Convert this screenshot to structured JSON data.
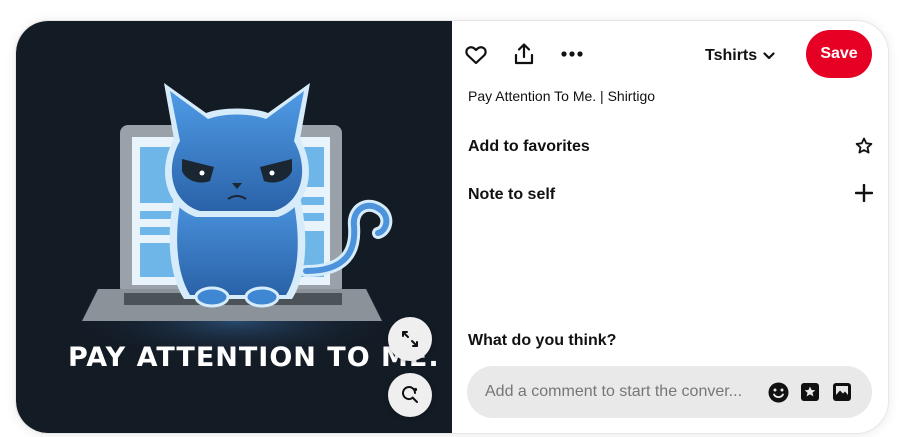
{
  "media": {
    "artwork_caption": "PAY ATTENTION TO ME.",
    "expand_icon": "expand-arrows-icon",
    "visual_search_icon": "visual-search-icon"
  },
  "toolbar": {
    "like_icon": "heart-icon",
    "share_icon": "share-icon",
    "more_icon": "ellipsis-icon",
    "board_name": "Tshirts",
    "save_label": "Save"
  },
  "pin": {
    "title": "Pay Attention To Me. | Shirtigo"
  },
  "actions": {
    "favorites_label": "Add to favorites",
    "favorites_icon": "star-outline-icon",
    "note_label": "Note to self",
    "note_icon": "plus-icon"
  },
  "comments": {
    "heading": "What do you think?",
    "placeholder": "Add a comment to start the conver...",
    "emoji_icon": "emoji-icon",
    "sticker_icon": "sticker-icon",
    "image_icon": "image-icon"
  },
  "colors": {
    "save_red": "#e60023",
    "art_background": "#131b25",
    "cat_blue": "#3f86d3"
  }
}
